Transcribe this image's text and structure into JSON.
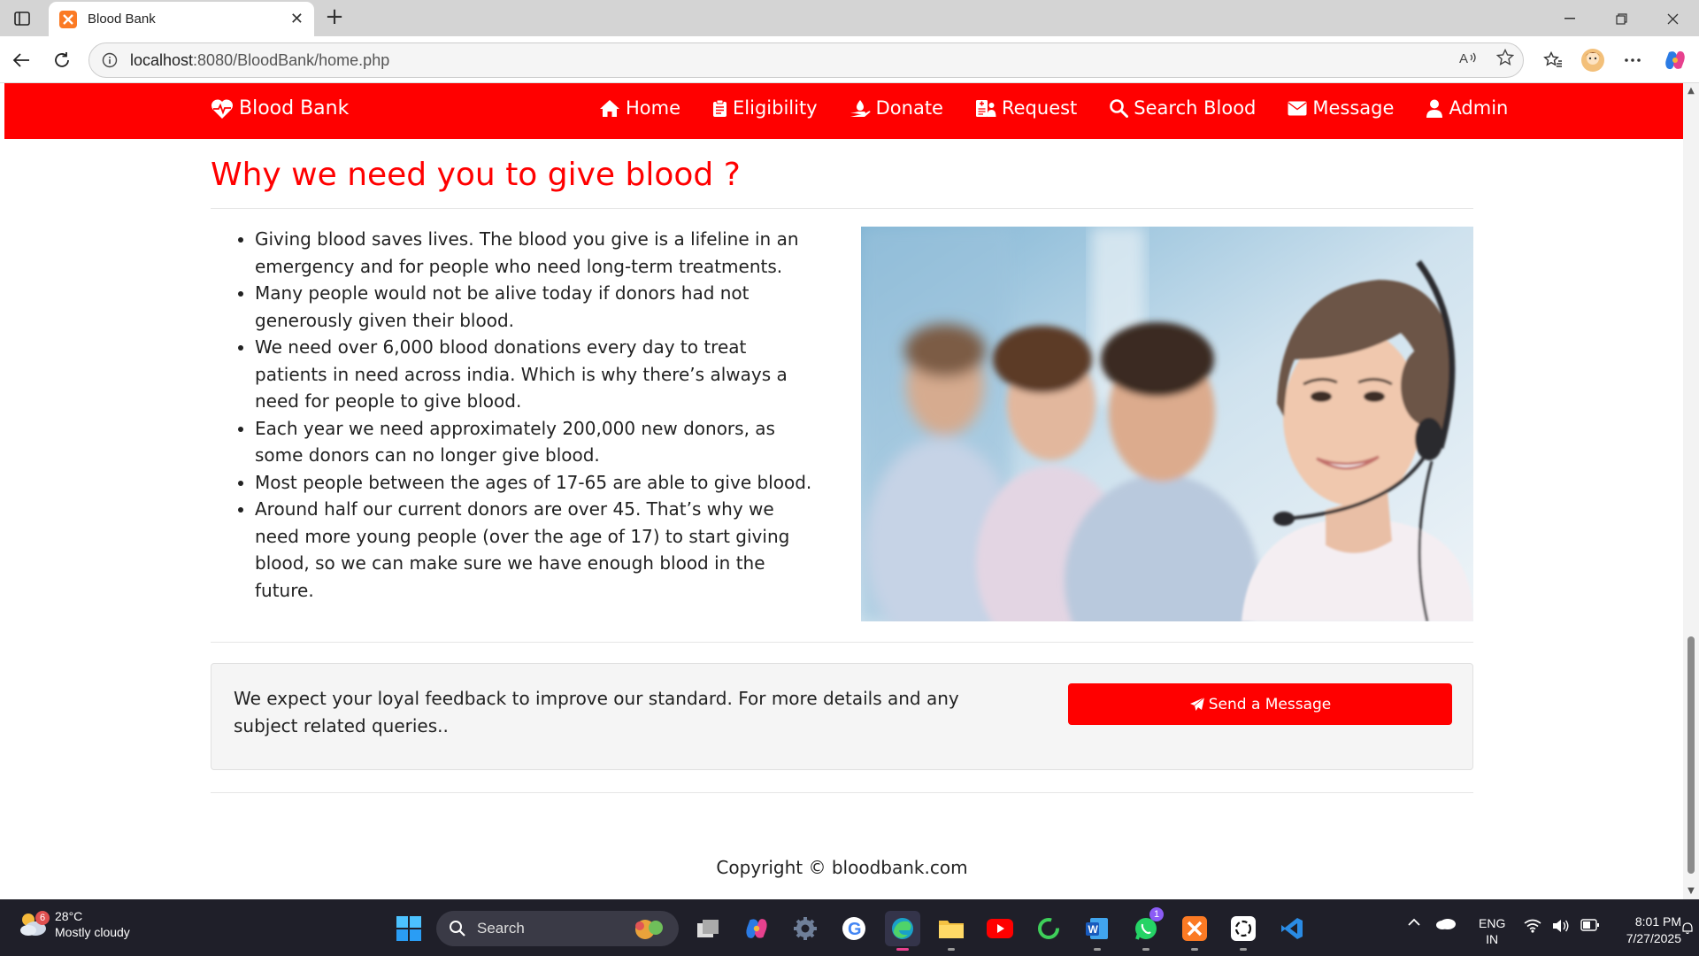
{
  "browser": {
    "tab_title": "Blood Bank",
    "new_tab_label": "+",
    "close_tab_label": "✕",
    "url_host": "localhost",
    "url_rest": ":8080/BloodBank/home.php"
  },
  "navbar": {
    "brand": "Blood Bank",
    "links": [
      "Home",
      "Eligibility",
      "Donate",
      "Request",
      "Search Blood",
      "Message",
      "Admin"
    ],
    "bg_color": "#ff0000"
  },
  "main": {
    "title": "Why we need you to give blood ?",
    "facts": [
      "Giving blood saves lives. The blood you give is a lifeline in an emergency and for people who need long-term treatments.",
      "Many people would not be alive today if donors had not generously given their blood.",
      "We need over 6,000 blood donations every day to treat patients in need across india. Which is why there’s always a need for people to give blood.",
      "Each year we need approximately 200,000 new donors, as some donors can no longer give blood.",
      "Most people between the ages of 17-65 are able to give blood.",
      "Around half our current donors are over 45. That’s why we need more young people (over the age of 17) to start giving blood, so we can make sure we have enough blood in the future."
    ],
    "feedback_text": "We expect your loyal feedback to improve our standard. For more details and any subject related queries..",
    "send_button": "Send a Message",
    "footer": "Copyright © bloodbank.com"
  },
  "taskbar": {
    "temperature": "28°C",
    "weather": "Mostly cloudy",
    "weather_badge": "6",
    "search_label": "Search",
    "whatsapp_badge": "1",
    "lang_top": "ENG",
    "lang_bottom": "IN",
    "time": "8:01 PM",
    "date": "7/27/2025"
  }
}
